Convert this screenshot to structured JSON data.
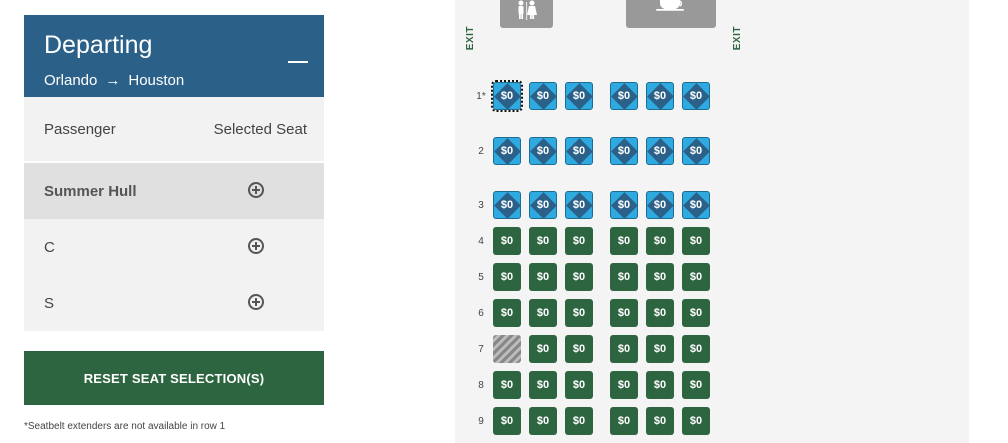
{
  "leg": {
    "title": "Departing",
    "from": "Orlando",
    "arrow": "→",
    "to": "Houston"
  },
  "columns": {
    "passenger": "Passenger",
    "selected_seat": "Selected Seat"
  },
  "passengers": [
    {
      "name": "Summer Hull",
      "active": true
    },
    {
      "name": "C",
      "active": false
    },
    {
      "name": "S",
      "active": false
    }
  ],
  "reset_label": "RESET SEAT SELECTION(S)",
  "footnote": "*Seatbelt extenders are not available in row 1",
  "exit_label": "EXIT",
  "row_note_marker": "*",
  "amenities": [
    {
      "icon": "restroom-icon"
    },
    {
      "icon": "coffee-icon"
    }
  ],
  "seat_rows": [
    {
      "row": "1",
      "note": "*",
      "type": "preferred",
      "price": "$0",
      "seats": [
        "selected",
        "available",
        "available",
        "available",
        "available",
        "available"
      ]
    },
    {
      "row": "2",
      "type": "preferred",
      "price": "$0",
      "seats": [
        "available",
        "available",
        "available",
        "available",
        "available",
        "available"
      ]
    },
    {
      "row": "3",
      "type": "preferred",
      "price": "$0",
      "seats": [
        "available",
        "available",
        "available",
        "available",
        "available",
        "available"
      ]
    },
    {
      "row": "4",
      "type": "standard",
      "price": "$0",
      "seats": [
        "available",
        "available",
        "available",
        "available",
        "available",
        "available"
      ]
    },
    {
      "row": "5",
      "type": "standard",
      "price": "$0",
      "seats": [
        "available",
        "available",
        "available",
        "available",
        "available",
        "available"
      ]
    },
    {
      "row": "6",
      "type": "standard",
      "price": "$0",
      "seats": [
        "available",
        "available",
        "available",
        "available",
        "available",
        "available"
      ]
    },
    {
      "row": "7",
      "type": "standard",
      "price": "$0",
      "seats": [
        "unavailable",
        "available",
        "available",
        "available",
        "available",
        "available"
      ]
    },
    {
      "row": "8",
      "type": "standard",
      "price": "$0",
      "seats": [
        "available",
        "available",
        "available",
        "available",
        "available",
        "available"
      ]
    },
    {
      "row": "9",
      "type": "standard",
      "price": "$0",
      "seats": [
        "available",
        "available",
        "available",
        "available",
        "available",
        "available"
      ]
    }
  ],
  "colors": {
    "header_blue": "#2b6189",
    "standard_green": "#2e6541",
    "preferred_light": "#2faae1",
    "preferred_dark": "#2b6189",
    "unavailable_gray": "#888888"
  }
}
